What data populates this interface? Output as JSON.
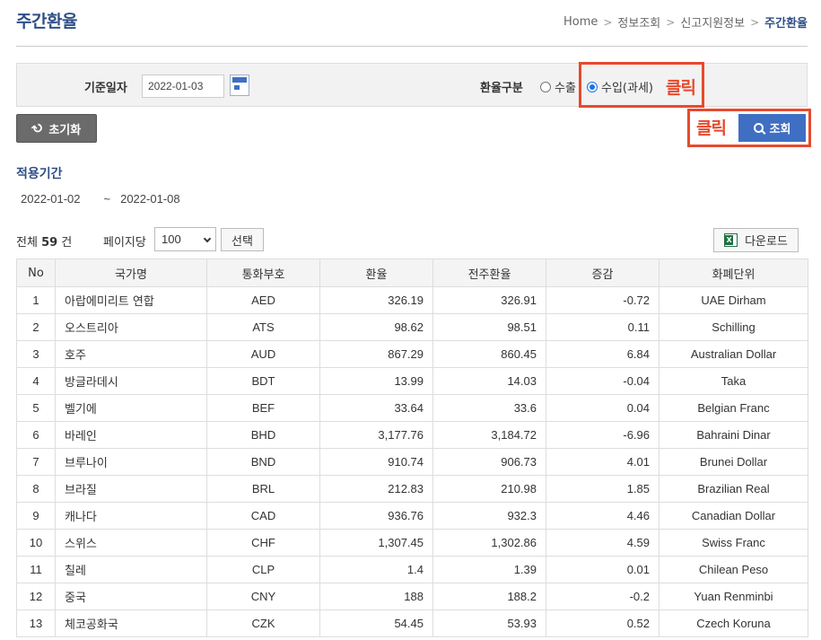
{
  "page": {
    "title": "주간환율",
    "breadcrumb": [
      "Home",
      "정보조회",
      "신고지원정보",
      "주간환율"
    ]
  },
  "search": {
    "date_label": "기준일자",
    "date_value": "2022-01-03",
    "type_label": "환율구분",
    "option_export": "수출",
    "option_import": "수입(과세)",
    "selected": "수입(과세)",
    "annotation_1": "클릭",
    "annotation_2": "클릭",
    "reset_label": "초기화",
    "search_label": "조회"
  },
  "period": {
    "title": "적용기간",
    "start": "2022-01-02",
    "separator": "~",
    "end": "2022-01-08"
  },
  "list": {
    "total_prefix": "전체",
    "total_count": "59",
    "total_suffix": "건",
    "perpage_label": "페이지당",
    "perpage_value": "100",
    "select_label": "선택",
    "download_label": "다운로드"
  },
  "table": {
    "headers": [
      "No",
      "국가명",
      "통화부호",
      "환율",
      "전주환율",
      "증감",
      "화폐단위"
    ],
    "rows": [
      [
        "1",
        "아랍에미리트 연합",
        "AED",
        "326.19",
        "326.91",
        "-0.72",
        "UAE Dirham"
      ],
      [
        "2",
        "오스트리아",
        "ATS",
        "98.62",
        "98.51",
        "0.11",
        "Schilling"
      ],
      [
        "3",
        "호주",
        "AUD",
        "867.29",
        "860.45",
        "6.84",
        "Australian Dollar"
      ],
      [
        "4",
        "방글라데시",
        "BDT",
        "13.99",
        "14.03",
        "-0.04",
        "Taka"
      ],
      [
        "5",
        "벨기에",
        "BEF",
        "33.64",
        "33.6",
        "0.04",
        "Belgian Franc"
      ],
      [
        "6",
        "바레인",
        "BHD",
        "3,177.76",
        "3,184.72",
        "-6.96",
        "Bahraini Dinar"
      ],
      [
        "7",
        "브루나이",
        "BND",
        "910.74",
        "906.73",
        "4.01",
        "Brunei Dollar"
      ],
      [
        "8",
        "브라질",
        "BRL",
        "212.83",
        "210.98",
        "1.85",
        "Brazilian Real"
      ],
      [
        "9",
        "캐나다",
        "CAD",
        "936.76",
        "932.3",
        "4.46",
        "Canadian Dollar"
      ],
      [
        "10",
        "스위스",
        "CHF",
        "1,307.45",
        "1,302.86",
        "4.59",
        "Swiss Franc"
      ],
      [
        "11",
        "칠레",
        "CLP",
        "1.4",
        "1.39",
        "0.01",
        "Chilean Peso"
      ],
      [
        "12",
        "중국",
        "CNY",
        "188",
        "188.2",
        "-0.2",
        "Yuan Renminbi"
      ],
      [
        "13",
        "체코공화국",
        "CZK",
        "54.45",
        "53.93",
        "0.52",
        "Czech Koruna"
      ]
    ]
  },
  "colors": {
    "accent": "#2f4f86",
    "button_blue": "#3f6fc3",
    "annotation_red": "#e64a2e"
  }
}
